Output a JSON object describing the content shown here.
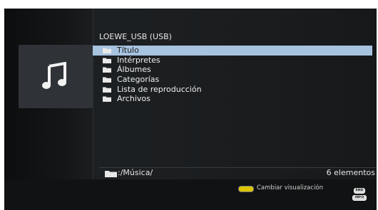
{
  "source": {
    "title": "LOEWE_USB (USB)"
  },
  "thumbnail": {
    "icon": "music-note-icon"
  },
  "menu": {
    "items": [
      {
        "label": "Título",
        "icon": "folder-icon",
        "selected": true
      },
      {
        "label": "Intérpretes",
        "icon": "folder-icon",
        "selected": false
      },
      {
        "label": "Álbumes",
        "icon": "folder-icon",
        "selected": false
      },
      {
        "label": "Categorías",
        "icon": "folder-icon",
        "selected": false
      },
      {
        "label": "Lista de reproducción",
        "icon": "folder-icon",
        "selected": false
      },
      {
        "label": "Archivos",
        "icon": "folder-icon",
        "selected": false
      }
    ]
  },
  "status": {
    "path": ":/Música/",
    "count": "6 elementos"
  },
  "footer": {
    "yellow_action": "Cambiar visualización",
    "end_key": "END",
    "info_key": "INFO"
  },
  "colors": {
    "selection": "#a7c3e0",
    "yellow_key": "#ddc600",
    "background": "#191b1d"
  }
}
